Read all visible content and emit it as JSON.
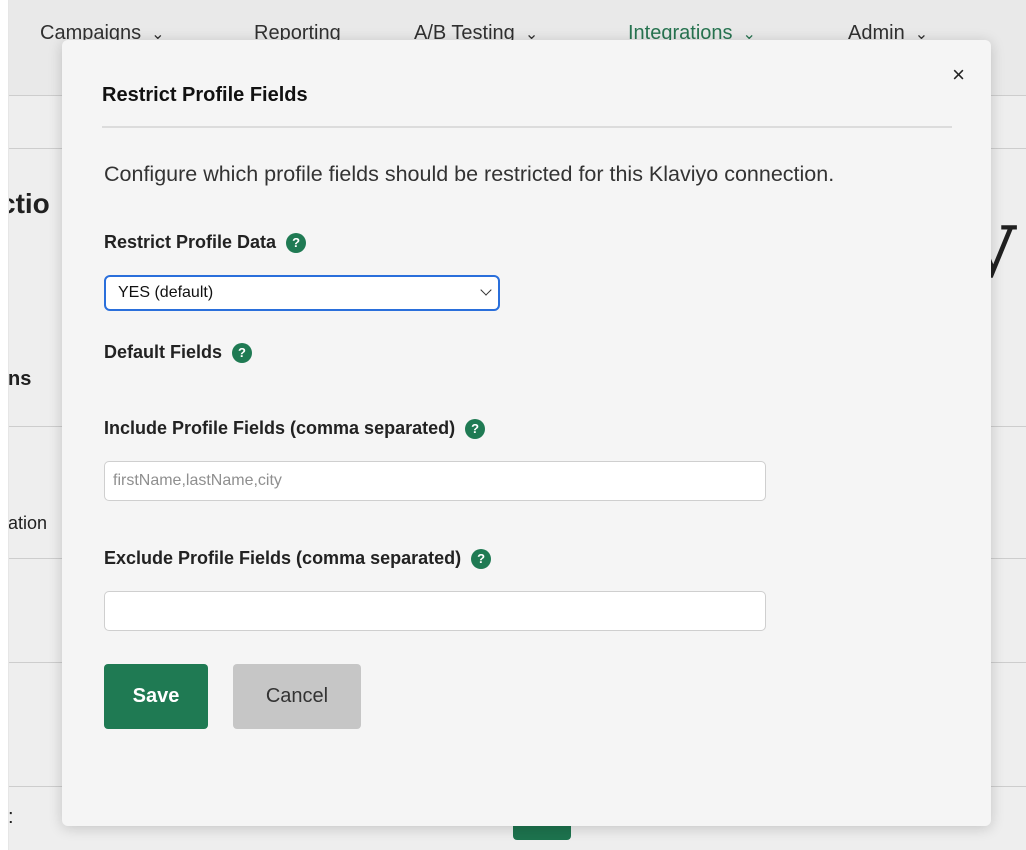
{
  "background": {
    "nav": [
      {
        "label": "Campaigns",
        "chevron": true,
        "active": false
      },
      {
        "label": "Reporting",
        "chevron": false,
        "active": false
      },
      {
        "label": "A/B Testing",
        "chevron": true,
        "active": false
      },
      {
        "label": "Integrations",
        "chevron": true,
        "active": true
      },
      {
        "label": "Admin",
        "chevron": true,
        "active": false
      }
    ],
    "fragments": {
      "heading": "ctio",
      "subheading": "ns",
      "row_text": "ation",
      "right_letter": "V",
      "bottom_char": ":"
    }
  },
  "modal": {
    "title": "Restrict Profile Fields",
    "close_glyph": "×",
    "description": "Configure which profile fields should be restricted for this Klaviyo connection.",
    "restrict_label": "Restrict Profile Data",
    "restrict_value": "YES (default)",
    "default_fields_label": "Default Fields",
    "include_label": "Include Profile Fields (comma separated)",
    "include_placeholder": "firstName,lastName,city",
    "include_value": "",
    "exclude_label": "Exclude Profile Fields (comma separated)",
    "exclude_placeholder": "",
    "exclude_value": "",
    "save_label": "Save",
    "cancel_label": "Cancel",
    "help_glyph": "?"
  },
  "colors": {
    "accent_green": "#1f7a53",
    "focus_blue": "#2a6fdb",
    "cancel_gray": "#c6c6c6"
  }
}
